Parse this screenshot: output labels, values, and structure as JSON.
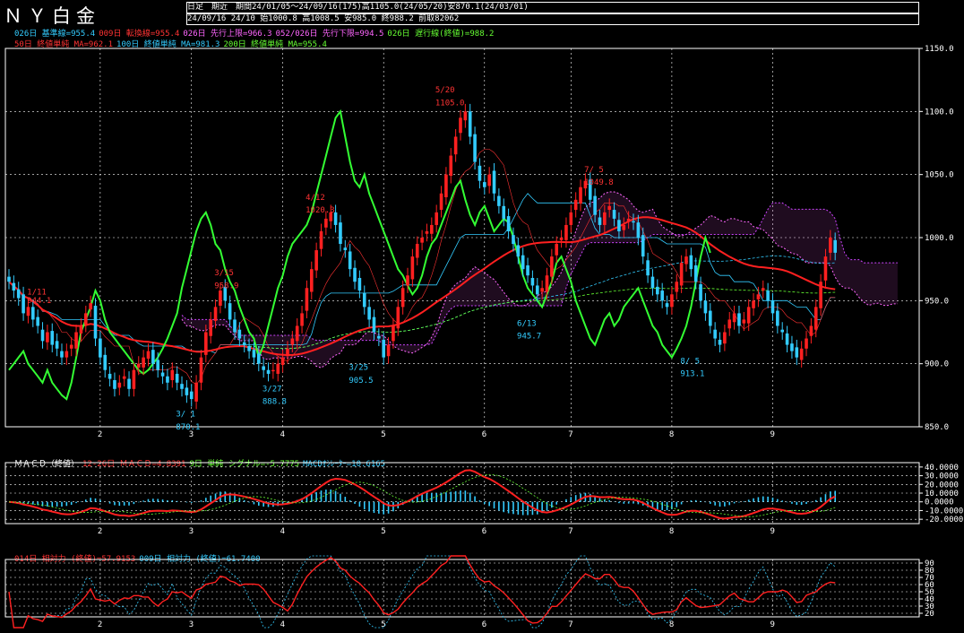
{
  "header": {
    "title": "ＮＹ白金",
    "info_line1": "日足　期近　期間24/01/05～24/09/16(175)高1105.0(24/05/20)安870.1(24/03/01)",
    "info_line2": "24/09/16 24/10 始1000.8 高1008.5 安985.0 終988.2 前取82062"
  },
  "legend_main_1": [
    {
      "text": "026日 基準線=955.4",
      "color": "#33ccff"
    },
    {
      "text": "009日 転換線=955.4",
      "color": "#ff3333"
    },
    {
      "text": "026日 先行上限=966.3",
      "color": "#ff66ff"
    },
    {
      "text": "052/026日 先行下限=994.5",
      "color": "#ff66ff"
    },
    {
      "text": "026日 遅行線(終値)=988.2",
      "color": "#66ff33"
    }
  ],
  "legend_main_2": [
    {
      "text": "50日 終値単純 MA=962.1",
      "color": "#ff3333"
    },
    {
      "text": "100日 終値単純 MA=981.3",
      "color": "#33ccff"
    },
    {
      "text": "200日 終値単純 MA=955.4",
      "color": "#66ff33"
    }
  ],
  "legend_macd": [
    {
      "text": "ＭＡＣＤ（終値）",
      "color": "#ffffff"
    },
    {
      "text": "12-26日 ＭＡＣＤ=4.8391",
      "color": "#ff3333"
    },
    {
      "text": "9日 単純 シグナル=-5.7775",
      "color": "#66ff33"
    },
    {
      "text": "MACDｵｼﾚｰﾀｰ=10.6165",
      "color": "#33ccff"
    }
  ],
  "legend_rsi": [
    {
      "text": "014日 相対力 (終値)=57.9153",
      "color": "#ff3333"
    },
    {
      "text": "009日 相対力 (終値)=61.7400",
      "color": "#33ccff"
    }
  ],
  "colors": {
    "up": "#ff2020",
    "down": "#33ccff",
    "ma50": "#ff2020",
    "lag": "#33ff33",
    "cloud": "#ff66ff",
    "grid": "#ffffff",
    "axis": "#ffffff"
  },
  "chart_data": [
    {
      "type": "candlestick",
      "title": "",
      "ylim": [
        850,
        1150
      ],
      "y_ticks": [
        850,
        900,
        950,
        1000,
        1050,
        1100,
        1150
      ],
      "y_tick_labels": [
        "850.0",
        "900.0",
        "950.0",
        "1000.0",
        "1050.0",
        "1100.0",
        "1150.0"
      ],
      "x_ticks": [
        "2",
        "3",
        "4",
        "5",
        "6",
        "7",
        "8",
        "9"
      ],
      "x_tick_index": [
        19,
        38,
        57,
        78,
        99,
        117,
        138,
        159
      ],
      "n_bars": 175,
      "close": [
        965,
        958,
        952,
        940,
        945,
        935,
        930,
        918,
        925,
        915,
        912,
        905,
        910,
        915,
        925,
        930,
        940,
        948,
        920,
        905,
        895,
        888,
        880,
        885,
        890,
        880,
        895,
        900,
        905,
        910,
        900,
        895,
        890,
        885,
        895,
        885,
        880,
        875,
        872,
        885,
        905,
        925,
        935,
        945,
        958,
        950,
        935,
        925,
        920,
        915,
        910,
        905,
        900,
        895,
        892,
        895,
        900,
        905,
        912,
        920,
        930,
        940,
        960,
        975,
        990,
        1005,
        1015,
        1020,
        1010,
        995,
        990,
        975,
        965,
        958,
        945,
        935,
        925,
        920,
        905,
        915,
        930,
        945,
        960,
        970,
        985,
        995,
        1000,
        1005,
        1010,
        1020,
        1035,
        1050,
        1065,
        1080,
        1095,
        1100,
        1080,
        1060,
        1045,
        1040,
        1050,
        1035,
        1025,
        1015,
        1005,
        995,
        985,
        975,
        970,
        962,
        955,
        960,
        970,
        985,
        995,
        1000,
        1010,
        1020,
        1030,
        1040,
        1045,
        1030,
        1018,
        1010,
        1020,
        1025,
        1015,
        1005,
        1010,
        1015,
        1012,
        1000,
        985,
        970,
        960,
        955,
        950,
        945,
        955,
        965,
        980,
        985,
        975,
        965,
        950,
        940,
        930,
        920,
        915,
        925,
        935,
        940,
        930,
        935,
        945,
        950,
        955,
        960,
        950,
        940,
        930,
        925,
        915,
        910,
        905,
        912,
        920,
        930,
        945,
        965,
        985,
        1000,
        988
      ],
      "labels": [
        {
          "text": "1/11",
          "value": 955,
          "bar": 6,
          "color": "#ff3333"
        },
        {
          "text": "944.1",
          "value": 948,
          "bar": 6,
          "color": "#ff3333"
        },
        {
          "text": "3/ 1",
          "value": 858,
          "bar": 37,
          "color": "#33ccff"
        },
        {
          "text": "870.1",
          "value": 848,
          "bar": 37,
          "color": "#33ccff"
        },
        {
          "text": "3/15",
          "value": 970,
          "bar": 45,
          "color": "#ff3333"
        },
        {
          "text": "958.9",
          "value": 960,
          "bar": 45,
          "color": "#ff3333"
        },
        {
          "text": "3/27",
          "value": 878,
          "bar": 55,
          "color": "#33ccff"
        },
        {
          "text": "888.8",
          "value": 868,
          "bar": 55,
          "color": "#33ccff"
        },
        {
          "text": "3/25",
          "value": 895,
          "bar": 73,
          "color": "#33ccff"
        },
        {
          "text": "905.5",
          "value": 885,
          "bar": 73,
          "color": "#33ccff"
        },
        {
          "text": "4/12",
          "value": 1030,
          "bar": 64,
          "color": "#ff3333"
        },
        {
          "text": "1020.3",
          "value": 1020,
          "bar": 64,
          "color": "#ff3333"
        },
        {
          "text": "5/20",
          "value": 1115,
          "bar": 91,
          "color": "#ff3333"
        },
        {
          "text": "1105.0",
          "value": 1105,
          "bar": 91,
          "color": "#ff3333"
        },
        {
          "text": "6/13",
          "value": 930,
          "bar": 108,
          "color": "#33ccff"
        },
        {
          "text": "945.7",
          "value": 920,
          "bar": 108,
          "color": "#33ccff"
        },
        {
          "text": "7/ 5",
          "value": 1052,
          "bar": 122,
          "color": "#ff3333"
        },
        {
          "text": "1049.8",
          "value": 1042,
          "bar": 122,
          "color": "#ff3333"
        },
        {
          "text": "8/ 5",
          "value": 900,
          "bar": 142,
          "color": "#33ccff"
        },
        {
          "text": "913.1",
          "value": 890,
          "bar": 142,
          "color": "#33ccff"
        }
      ]
    },
    {
      "type": "line",
      "title": "MACD",
      "ylim": [
        -25,
        45
      ],
      "y_ticks": [
        -20,
        -10,
        0,
        10,
        20,
        30,
        40
      ],
      "y_tick_labels": [
        "-20.0000",
        "-10.0000",
        "0.0000",
        "10.0000",
        "20.0000",
        "30.0000",
        "40.0000"
      ]
    },
    {
      "type": "line",
      "title": "RSI",
      "ylim": [
        15,
        95
      ],
      "y_ticks": [
        20,
        30,
        40,
        50,
        60,
        70,
        80,
        90
      ],
      "y_tick_labels": [
        "20",
        "30",
        "40",
        "50",
        "60",
        "70",
        "80",
        "90"
      ]
    }
  ]
}
